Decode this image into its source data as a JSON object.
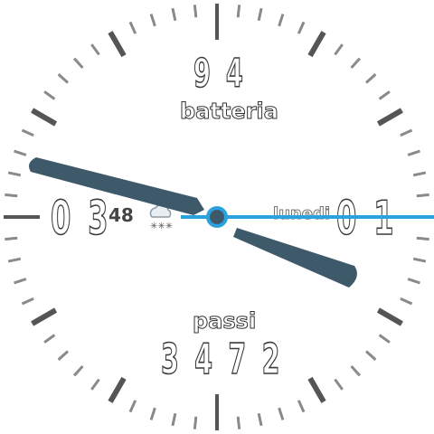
{
  "battery": {
    "value": "9 4",
    "label": "batteria"
  },
  "time": {
    "hours": "0 3",
    "minutes": "48"
  },
  "date": {
    "day": "0 1",
    "weekday": "lunedi"
  },
  "steps": {
    "label": "passi",
    "value": "3 4 7 2"
  },
  "weather": {
    "icon": "snow-cloud-icon"
  },
  "hands": {
    "hour_angle_deg": 116,
    "minute_angle_deg": 288,
    "second_angle_deg": 90
  },
  "colors": {
    "hand": "#3e5a6a",
    "second_hand": "#2ba1de",
    "tick": "#8a8a8a",
    "major_tick": "#555555"
  }
}
